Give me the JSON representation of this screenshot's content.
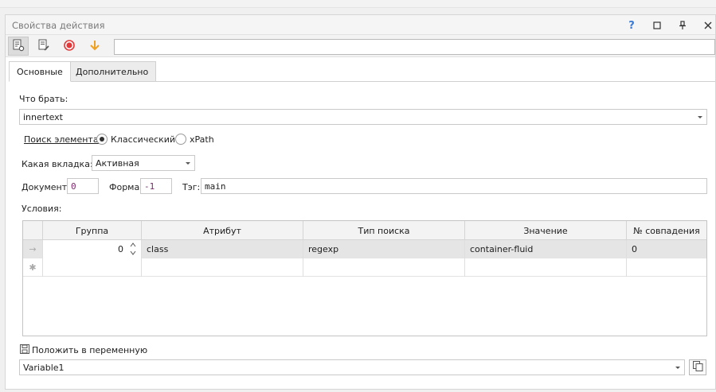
{
  "window": {
    "title": "Свойства действия",
    "help_glyph": "?"
  },
  "tabs": [
    {
      "label": "Основные",
      "selected": true
    },
    {
      "label": "Дополнительно",
      "selected": false
    }
  ],
  "form": {
    "what_to_take_label": "Что брать:",
    "what_to_take_value": "innertext",
    "search_element_label": "Поиск элемента:",
    "search_modes": [
      {
        "label": "Классический",
        "selected": true
      },
      {
        "label": "xPath",
        "selected": false
      }
    ],
    "which_tab_label": "Какая вкладка:",
    "which_tab_value": "Активная",
    "document_label": "Документ:",
    "document_value": "0",
    "form_label": "Форма:",
    "form_value": "-1",
    "tag_label": "Тэг:",
    "tag_value": "main",
    "conditions_label": "Условия:"
  },
  "conditions_table": {
    "columns": [
      "Группа",
      "Атрибут",
      "Тип поиска",
      "Значение",
      "№ совпадения"
    ],
    "rows": [
      {
        "group": "0",
        "attribute": "class",
        "search_type": "regexp",
        "value": "container-fluid",
        "match_no": "0"
      }
    ],
    "row_marker": "→",
    "new_row_marker": "✱"
  },
  "save_to_variable": {
    "label": "Положить в переменную",
    "value": "Variable1"
  },
  "colors": {
    "record": "#e23a3a",
    "arrow": "#f0a020",
    "help": "#3b7bd8",
    "border": "#c9c9c9",
    "selected_row": "#e5e5e5"
  },
  "icons": {
    "toolbar": [
      "settings-doc-icon",
      "edit-doc-icon",
      "record-icon",
      "arrow-down-icon"
    ],
    "window": [
      "help-icon",
      "maximize-icon",
      "pin-icon",
      "close-icon"
    ],
    "variable": "save-icon",
    "copy": "copy-icon"
  }
}
